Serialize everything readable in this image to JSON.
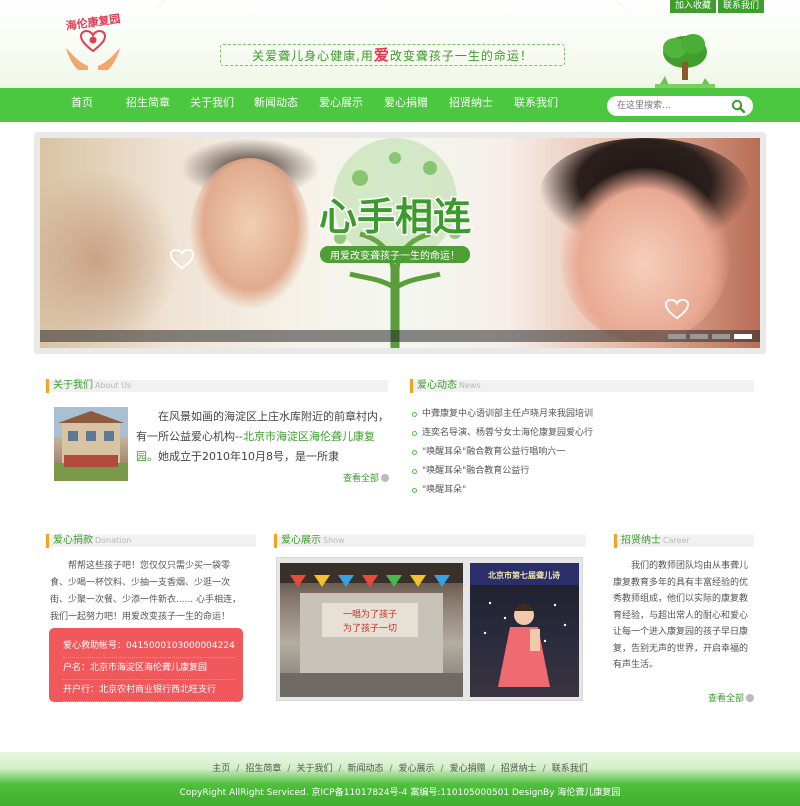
{
  "toplinks": {
    "favorite": "加入收藏",
    "contact": "联系我们"
  },
  "logo": {
    "text": "海伦康复园"
  },
  "slogan": {
    "part1": "关爱聋儿身心健康,用",
    "highlight": "爱",
    "part2": "改变聋孩子一生的命运！"
  },
  "nav": {
    "items": [
      "首页",
      "招生简章",
      "关于我们",
      "新闻动态",
      "爱心展示",
      "爱心捐赠",
      "招贤纳士",
      "联系我们"
    ]
  },
  "search": {
    "placeholder": "在这里搜索..."
  },
  "banner": {
    "title": "心手相连",
    "subtitle": "用爱改变聋孩子一生的命运！",
    "slide_count": 4,
    "active_slide": 4
  },
  "about": {
    "title": "关于我们",
    "title_en": "About Us",
    "text_before": "在风景如画的海淀区上庄水库附近的前章村内，有一所公益爱心机构--",
    "text_highlight": "北京市海淀区海伦聋儿康复园。",
    "text_after": "她成立于2010年10月8号，是一所隶",
    "more": "查看全部"
  },
  "news": {
    "title": "爱心动态",
    "title_en": "News",
    "items": [
      "中聋康复中心语训部主任卢晓月来我园培训",
      "连奕名导演、杨蓉兮女士海伦康复园爱心行",
      "\"唤醒耳朵\"融合教育公益行唱响六一",
      "\"唤醒耳朵\"融合教育公益行",
      "\"唤醒耳朵\""
    ]
  },
  "donation": {
    "title": "爱心捐款",
    "title_en": "Donation",
    "text": "帮帮这些孩子吧！您仅仅只需少买一袋零食、少喝一杯饮料、少抽一支香烟、少逛一次街、少聚一次餐、少添一件新衣...... 心手相连，我们一起努力吧！用爱改变孩子一生的命运！",
    "account": "爱心救助帐号：0415000103000004224",
    "name": "户名：北京市海淀区海伦聋儿康复园",
    "bank": "开户行：北京农村商业银行西北旺支行"
  },
  "show": {
    "title": "爱心展示",
    "title_en": "Show",
    "img1_text": [
      "一唱为了孩子",
      "为了孩子一切"
    ],
    "img2_text": "北京市第七届聋儿诗"
  },
  "career": {
    "title": "招贤纳士",
    "title_en": "Career",
    "text": "我们的教师团队均由从事聋儿康复教育多年的具有丰富经验的优秀教师组成，他们以实际的康复教育经验，与超出常人的耐心和爱心让每一个进入康复园的孩子早日康复，告别无声的世界，开启幸福的有声生活。",
    "more": "查看全部"
  },
  "footer": {
    "links": [
      "主页",
      "招生简章",
      "关于我们",
      "新闻动态",
      "爱心展示",
      "爱心捐赠",
      "招贤纳士",
      "联系我们"
    ],
    "copyright": "CopyRight AllRight Serviced. 京ICP备11017824号-4 案编号:110105000501 DesignBy 海伦聋儿康复园"
  },
  "colors": {
    "brand_green": "#4cc740",
    "accent_orange": "#f2a31f",
    "donation_red": "#f0585c"
  }
}
